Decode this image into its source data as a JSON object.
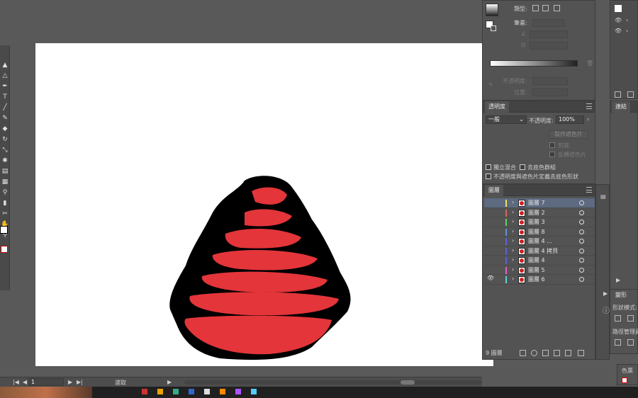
{
  "gradient_panel": {
    "type_label": "類型:",
    "stroke_label": "筆畫:",
    "opacity_label": "不透明度:",
    "position_label": "位置:"
  },
  "transparency_panel": {
    "tab_label": "透明度",
    "blend_mode": "一般",
    "opacity_label": "不透明度:",
    "opacity_value": "100%",
    "make_mask_button": "製作遮色片",
    "clip_label": "剪裁",
    "invert_mask_label": "反轉遮色片",
    "isolate_blending_label": "獨立混合",
    "knockout_group_label": "去底色群組",
    "opacity_mask_shape_label": "不透明度與遮色片定義去底色形狀"
  },
  "layers_panel": {
    "tab_label": "圖層",
    "layers": [
      {
        "name": "圖層 7",
        "color": "#f0e05a",
        "selected": true,
        "visible": false
      },
      {
        "name": "圖層 2",
        "color": "#e06060",
        "selected": false,
        "visible": false
      },
      {
        "name": "圖層 3",
        "color": "#60d060",
        "selected": false,
        "visible": false
      },
      {
        "name": "圖層 8",
        "color": "#6090e0",
        "selected": false,
        "visible": false
      },
      {
        "name": "圖層 4 ...",
        "color": "#6060e0",
        "selected": false,
        "visible": false
      },
      {
        "name": "圖層 4 拷貝",
        "color": "#6060e0",
        "selected": false,
        "visible": false
      },
      {
        "name": "圖層 4",
        "color": "#6060e0",
        "selected": false,
        "visible": false
      },
      {
        "name": "圖層 5",
        "color": "#e060d0",
        "selected": false,
        "visible": false
      },
      {
        "name": "圖層 6",
        "color": "#60d0d0",
        "selected": false,
        "visible": true
      }
    ],
    "layer_count": "9 圖層"
  },
  "right_panels": {
    "links_tab": "連結",
    "shape_modes_label": "形狀模式:",
    "pathfinder_label": "路徑管理員",
    "transform_tab": "變形",
    "color_tab": "色票"
  },
  "status_bar": {
    "artboard_number": "1",
    "status_text": "選取"
  },
  "colors": {
    "art_red": "#e3353a",
    "art_black": "#000000",
    "panel_bg": "#535353",
    "selection": "#5d6a80"
  }
}
